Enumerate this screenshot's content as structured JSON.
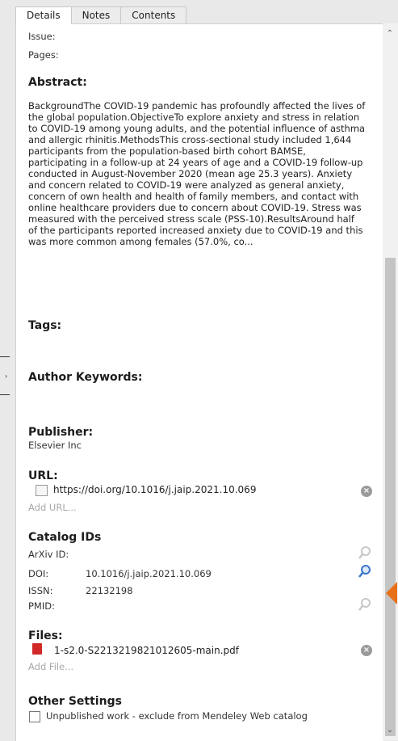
{
  "tabs": [
    {
      "label": "Details"
    },
    {
      "label": "Notes"
    },
    {
      "label": "Contents"
    }
  ],
  "fields": {
    "issue_label": "Issue:",
    "pages_label": "Pages:"
  },
  "abstract": {
    "heading": "Abstract:",
    "text": "BackgroundThe COVID-19 pandemic has profoundly affected the lives of the global population.ObjectiveTo explore anxiety and stress in relation to COVID-19 among young adults, and the potential influence of asthma and allergic rhinitis.MethodsThis cross-sectional study included 1,644 participants from the population-based birth cohort BAMSE, participating in a follow-up at 24 years of age and a COVID-19 follow-up conducted in August-November 2020 (mean age 25.3 years). Anxiety and concern related to COVID-19 were analyzed as general anxiety, concern of own health and health of family members, and contact with online healthcare providers due to concern about COVID-19. Stress was measured with the perceived stress scale (PSS-10).ResultsAround half of the participants reported increased anxiety due to COVID-19 and this was more common among females (57.0%, co..."
  },
  "tags": {
    "heading": "Tags:"
  },
  "author_keywords": {
    "heading": "Author Keywords:"
  },
  "publisher": {
    "heading": "Publisher:",
    "value": "Elsevier Inc"
  },
  "url": {
    "heading": "URL:",
    "value": "https://doi.org/10.1016/j.jaip.2021.10.069",
    "add_label": "Add URL..."
  },
  "catalog": {
    "heading": "Catalog IDs",
    "arxiv_label": "ArXiv ID:",
    "doi_label": "DOI:",
    "doi_value": "10.1016/j.jaip.2021.10.069",
    "issn_label": "ISSN:",
    "issn_value": "22132198",
    "pmid_label": "PMID:"
  },
  "files": {
    "heading": "Files:",
    "file_name": "1-s2.0-S2213219821012605-main.pdf",
    "add_label": "Add File..."
  },
  "other_settings": {
    "heading": "Other Settings",
    "unpublished_label": "Unpublished work - exclude from Mendeley Web catalog"
  },
  "colors": {
    "accent": "#e8701a",
    "pdf": "#d12828",
    "search_blue": "#3b74c9"
  }
}
